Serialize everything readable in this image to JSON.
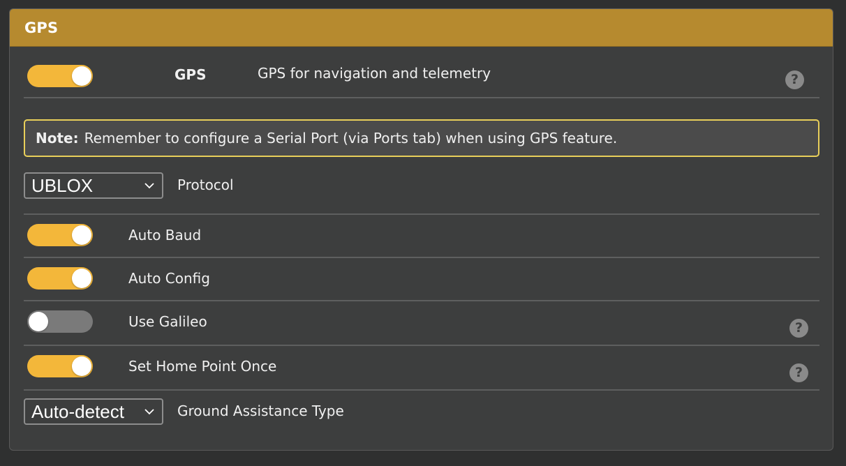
{
  "panel": {
    "title": "GPS"
  },
  "gps_feature": {
    "label": "GPS",
    "description": "GPS for navigation and telemetry",
    "enabled": true
  },
  "note": {
    "prefix": "Note:",
    "text": "Remember to configure a Serial Port (via Ports tab) when using GPS feature."
  },
  "protocol": {
    "selected": "UBLOX",
    "label": "Protocol"
  },
  "settings": [
    {
      "label": "Auto Baud",
      "enabled": true,
      "help": false
    },
    {
      "label": "Auto Config",
      "enabled": true,
      "help": false
    },
    {
      "label": "Use Galileo",
      "enabled": false,
      "help": true
    },
    {
      "label": "Set Home Point Once",
      "enabled": true,
      "help": true
    }
  ],
  "ground_assistance": {
    "selected": "Auto-detect",
    "label": "Ground Assistance Type"
  },
  "help_icon_glyph": "?",
  "icons": {
    "help": "question-circle-icon",
    "dropdown": "chevron-down-icon"
  },
  "colors": {
    "header": "#b68a2f",
    "toggle_on": "#f3b73a",
    "toggle_off": "#7a7a7a",
    "note_border": "#e9cf5a"
  }
}
